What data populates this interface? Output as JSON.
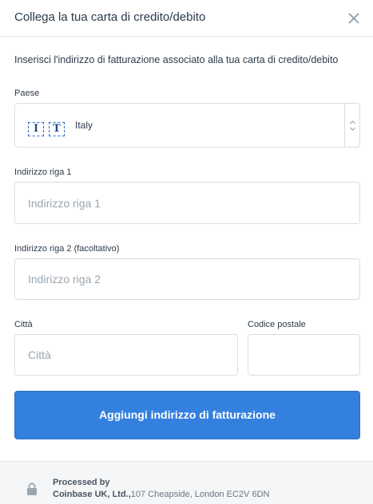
{
  "header": {
    "title": "Collega la tua carta di credito/debito"
  },
  "subtitle": "Inserisci l'indirizzo di fatturazione associato alla tua carta di credito/debito",
  "country": {
    "label": "Paese",
    "flag_letters": [
      "I",
      "T"
    ],
    "value": "Italy"
  },
  "address1": {
    "label": "Indirizzo riga 1",
    "placeholder": "Indirizzo riga 1",
    "value": ""
  },
  "address2": {
    "label": "Indirizzo riga 2 (facoltativo)",
    "placeholder": "Indirizzo riga 2",
    "value": ""
  },
  "city": {
    "label": "Città",
    "placeholder": "Città",
    "value": ""
  },
  "postal": {
    "label": "Codice postale",
    "placeholder": "",
    "value": ""
  },
  "submit_label": "Aggiungi indirizzo di fatturazione",
  "footer": {
    "processed_by": "Processed by",
    "company": "Coinbase UK, Ltd.,",
    "address": "107 Cheapside, London EC2V 6DN"
  },
  "colors": {
    "primary": "#3480df",
    "border": "#d8dde3",
    "footer_bg": "#f4f6f8"
  },
  "icons": [
    "close-icon",
    "chevron-up-down-icon",
    "lock-icon"
  ]
}
